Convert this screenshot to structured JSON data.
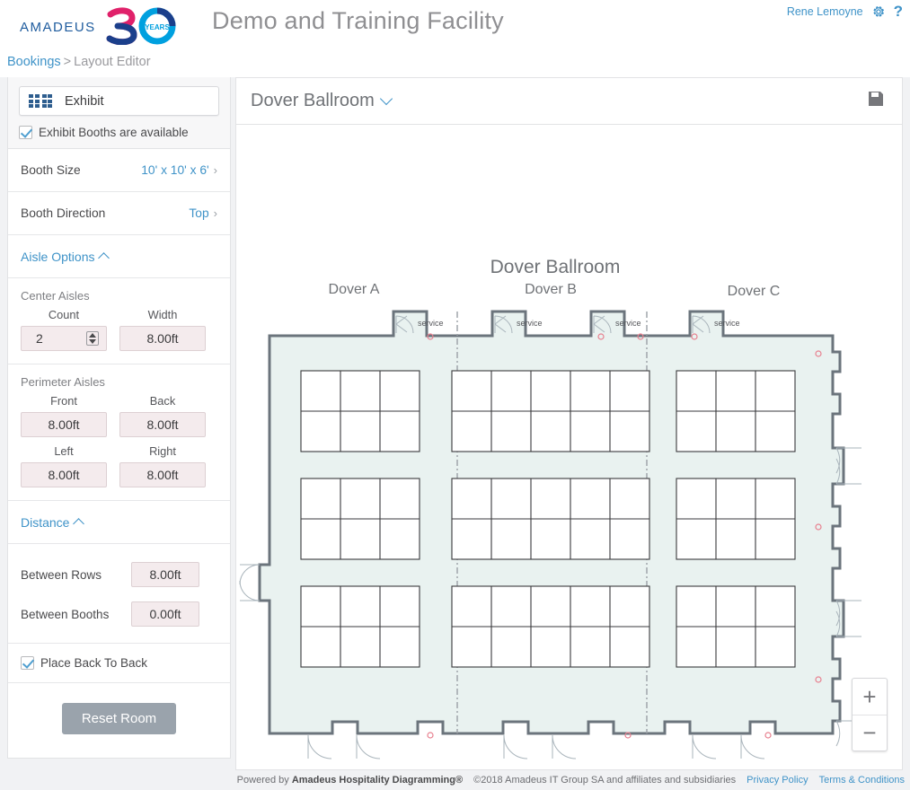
{
  "header": {
    "logo_text": "amadeus",
    "logo_badge": "30",
    "logo_badge_sub": "YEARS",
    "title": "Demo and Training Facility",
    "user_name": "Rene Lemoyne",
    "gear_icon": "gear-icon",
    "help_icon": "?"
  },
  "breadcrumb": {
    "root": "Bookings",
    "separator": ">",
    "current": "Layout Editor"
  },
  "sidebar": {
    "setup_type": "Exhibit",
    "setup_icon": "exhibit-booths-icon",
    "available_checkbox": {
      "label": "Exhibit Booths are available",
      "checked": true
    },
    "rows": [
      {
        "label": "Booth Size",
        "value": "10' x 10' x 6'"
      },
      {
        "label": "Booth Direction",
        "value": "Top"
      }
    ],
    "aisle_options": {
      "section_label": "Aisle Options",
      "center_label": "Center Aisles",
      "center_count_label": "Count",
      "center_count_value": "2",
      "center_width_label": "Width",
      "center_width_value": "8.00ft",
      "perimeter_label": "Perimeter Aisles",
      "front_label": "Front",
      "front_value": "8.00ft",
      "back_label": "Back",
      "back_value": "8.00ft",
      "left_label": "Left",
      "left_value": "8.00ft",
      "right_label": "Right",
      "right_value": "8.00ft"
    },
    "distance": {
      "section_label": "Distance",
      "between_rows_label": "Between Rows",
      "between_rows_value": "8.00ft",
      "between_booths_label": "Between Booths",
      "between_booths_value": "0.00ft"
    },
    "back_to_back": {
      "label": "Place Back To Back",
      "checked": true
    },
    "reset_label": "Reset Room"
  },
  "main": {
    "room_name": "Dover Ballroom",
    "save_icon": "save-icon",
    "zoom_in": "+",
    "zoom_out": "−"
  },
  "floorplan": {
    "title": "Dover Ballroom",
    "sub_rooms": [
      "Dover A",
      "Dover B",
      "Dover C"
    ],
    "service_labels": [
      "service",
      "service",
      "service",
      "service"
    ],
    "booth_blocks": [
      {
        "cols": 3,
        "rows": 2
      },
      {
        "cols": 5,
        "rows": 2
      },
      {
        "cols": 3,
        "rows": 2
      },
      {
        "cols": 3,
        "rows": 2
      },
      {
        "cols": 5,
        "rows": 2
      },
      {
        "cols": 3,
        "rows": 2
      },
      {
        "cols": 3,
        "rows": 2
      },
      {
        "cols": 5,
        "rows": 2
      },
      {
        "cols": 3,
        "rows": 2
      }
    ],
    "colors": {
      "floor_fill": "#e9f2f0",
      "wall": "#6b747c",
      "booth_line": "#3a3a3c",
      "partition": "#9aa0a6",
      "marker": "#e8808f"
    }
  },
  "footer": {
    "powered_by": "Powered by",
    "product": "Amadeus Hospitality Diagramming®",
    "copyright": "©2018 Amadeus IT Group SA and affiliates and subsidiaries",
    "privacy": "Privacy Policy",
    "terms": "Terms & Conditions"
  }
}
